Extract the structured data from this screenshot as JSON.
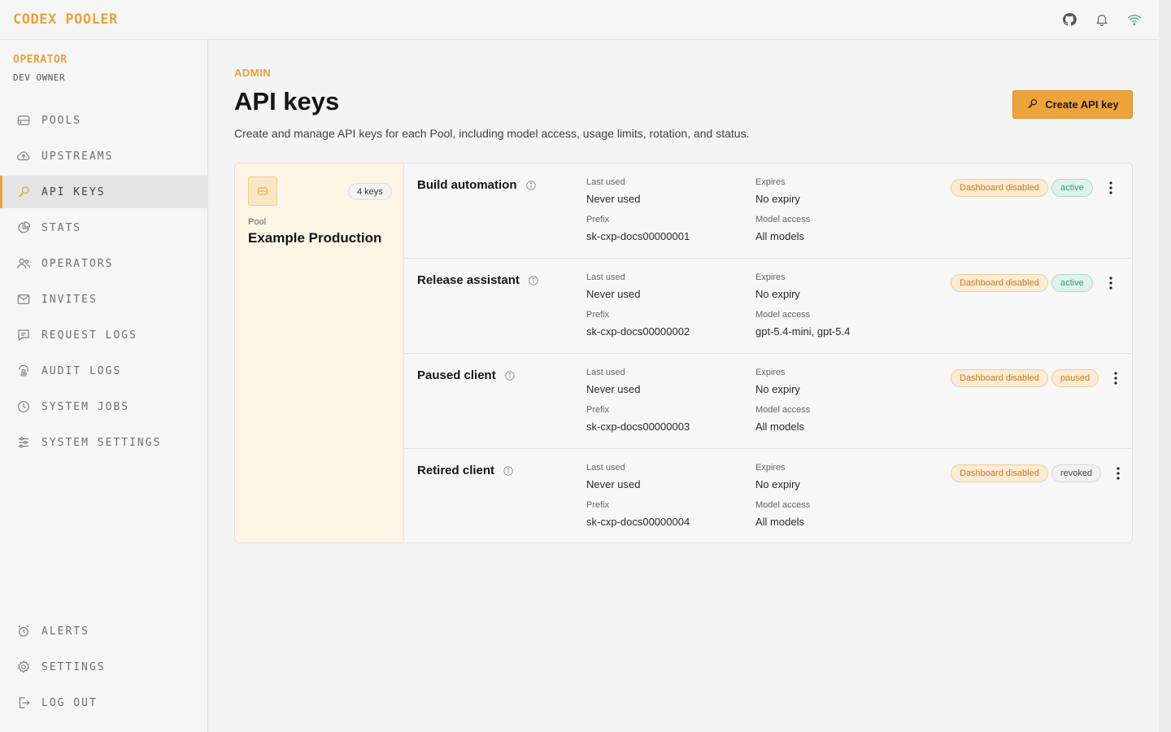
{
  "app": {
    "logo": "CODEX POOLER"
  },
  "topbar": {
    "icons": [
      "github-icon",
      "bell-icon",
      "wifi-icon"
    ]
  },
  "colors": {
    "accent": "#e9a23b",
    "active": "#3a9c80"
  },
  "operator": {
    "role": "OPERATOR",
    "name": "DEV OWNER"
  },
  "nav": {
    "items": [
      {
        "label": "POOLS",
        "icon": "database-icon"
      },
      {
        "label": "UPSTREAMS",
        "icon": "cloud-upload-icon"
      },
      {
        "label": "API KEYS",
        "icon": "key-icon",
        "active": true
      },
      {
        "label": "STATS",
        "icon": "pie-chart-icon"
      },
      {
        "label": "OPERATORS",
        "icon": "users-icon"
      },
      {
        "label": "INVITES",
        "icon": "mail-icon"
      },
      {
        "label": "REQUEST LOGS",
        "icon": "message-icon"
      },
      {
        "label": "AUDIT LOGS",
        "icon": "fingerprint-icon"
      },
      {
        "label": "SYSTEM JOBS",
        "icon": "clock-icon"
      },
      {
        "label": "SYSTEM SETTINGS",
        "icon": "sliders-icon"
      }
    ],
    "bottom": [
      {
        "label": "ALERTS",
        "icon": "alarm-icon"
      },
      {
        "label": "SETTINGS",
        "icon": "gear-icon"
      },
      {
        "label": "LOG OUT",
        "icon": "logout-icon"
      }
    ]
  },
  "page": {
    "section": "ADMIN",
    "title": "API keys",
    "description": "Create and manage API keys for each Pool, including model access, usage limits, rotation, and status.",
    "create_button": "Create API key"
  },
  "pool": {
    "label": "Pool",
    "name": "Example Production",
    "key_count": "4 keys"
  },
  "field_labels": {
    "last_used": "Last used",
    "expires": "Expires",
    "prefix": "Prefix",
    "model_access": "Model access"
  },
  "keys": [
    {
      "name": "Build automation",
      "last_used": "Never used",
      "expires": "No expiry",
      "prefix": "sk-cxp-docs00000001",
      "model_access": "All models",
      "dashboard": "Dashboard disabled",
      "status": "active"
    },
    {
      "name": "Release assistant",
      "last_used": "Never used",
      "expires": "No expiry",
      "prefix": "sk-cxp-docs00000002",
      "model_access": "gpt-5.4-mini, gpt-5.4",
      "dashboard": "Dashboard disabled",
      "status": "active"
    },
    {
      "name": "Paused client",
      "last_used": "Never used",
      "expires": "No expiry",
      "prefix": "sk-cxp-docs00000003",
      "model_access": "All models",
      "dashboard": "Dashboard disabled",
      "status": "paused"
    },
    {
      "name": "Retired client",
      "last_used": "Never used",
      "expires": "No expiry",
      "prefix": "sk-cxp-docs00000004",
      "model_access": "All models",
      "dashboard": "Dashboard disabled",
      "status": "revoked"
    }
  ]
}
